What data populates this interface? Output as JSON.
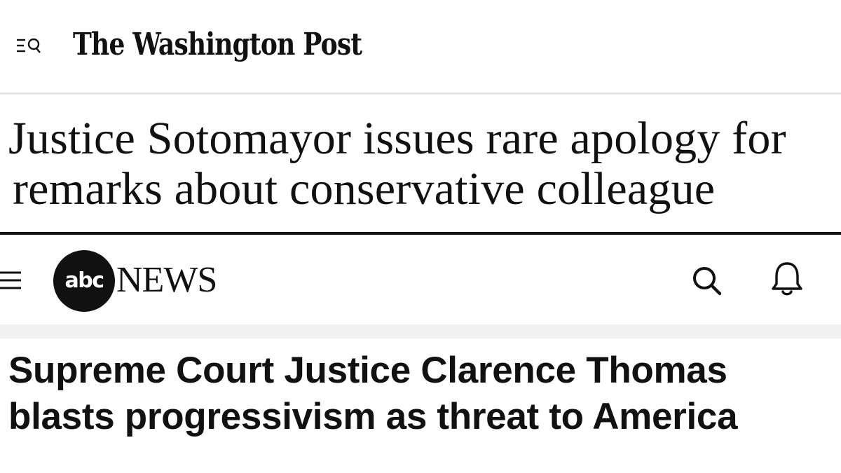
{
  "wapo": {
    "logo_text": "The Washington Post",
    "menu_icon": "menu-search-icon",
    "headline_line1": "Justice Sotomayor issues rare apology for",
    "headline_line2": "remarks about conservative colleague"
  },
  "abc": {
    "logo_circle_text": "abc",
    "logo_word": "NEWS",
    "menu_icon": "hamburger-icon",
    "search_icon": "search-icon",
    "bell_icon": "bell-icon",
    "headline_line1": "Supreme Court Justice Clarence Thomas",
    "headline_line2": "blasts progressivism as threat to America"
  },
  "colors": {
    "text": "#111111",
    "background": "#ffffff",
    "divider": "#e6e6e6",
    "band": "#f1f1f1"
  }
}
